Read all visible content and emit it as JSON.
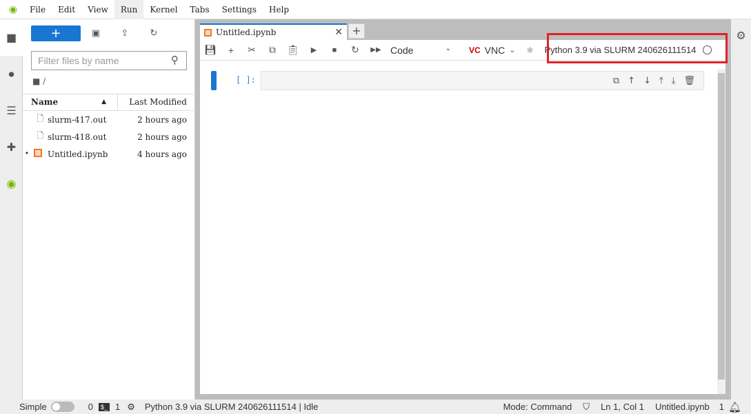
{
  "menubar": {
    "items": [
      "File",
      "Edit",
      "View",
      "Run",
      "Kernel",
      "Tabs",
      "Settings",
      "Help"
    ],
    "active": "Run"
  },
  "filebrowser": {
    "new_label": "+",
    "filter_placeholder": "Filter files by name",
    "breadcrumb": "/",
    "columns": {
      "name": "Name",
      "modified": "Last Modified"
    },
    "files": [
      {
        "name": "slurm-417.out",
        "modified": "2 hours ago",
        "type": "file",
        "running": false
      },
      {
        "name": "slurm-418.out",
        "modified": "2 hours ago",
        "type": "file",
        "running": false
      },
      {
        "name": "Untitled.ipynb",
        "modified": "4 hours ago",
        "type": "notebook",
        "running": true
      }
    ]
  },
  "notebook": {
    "tab_title": "Untitled.ipynb",
    "add_tab": "+",
    "cell_type": "Code",
    "vnc_label": "VNC",
    "kernel_name": "Python 3.9 via SLURM 240626111514",
    "prompt": "[ ]:"
  },
  "status": {
    "simple_label": "Simple",
    "simple_on": false,
    "terminals": "0",
    "kernels": "1",
    "kernel_status": "Python 3.9 via SLURM 240626111514 | Idle",
    "mode": "Mode: Command",
    "cursor": "Ln 1, Col 1",
    "filename": "Untitled.ipynb",
    "notifications": "1"
  },
  "colors": {
    "accent": "#1976d2",
    "highlight_box": "#e0202a",
    "nvidia_green": "#76b900",
    "notebook_icon": "#f37726"
  }
}
